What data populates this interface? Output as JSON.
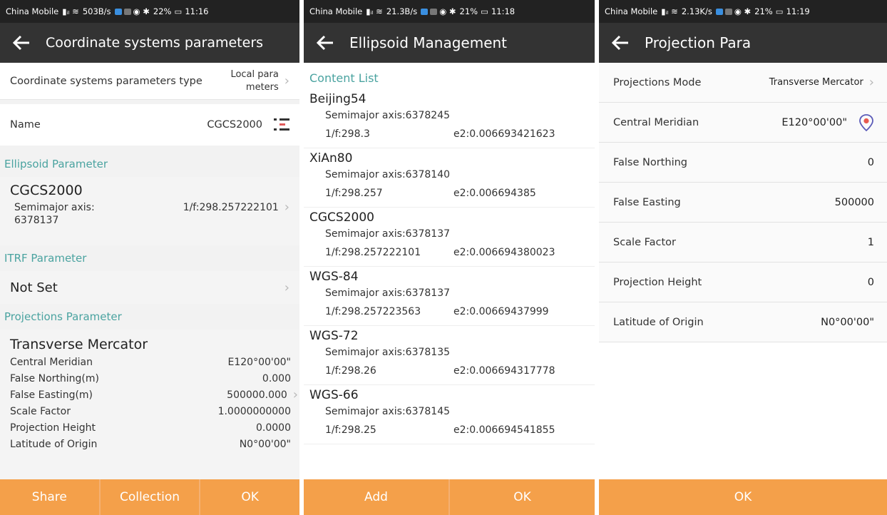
{
  "screen1": {
    "status": {
      "carrier": "China Mobile",
      "speed": "503B/s",
      "battery": "22%",
      "time": "11:16"
    },
    "title": "Coordinate systems parameters",
    "type_row": {
      "label": "Coordinate systems parameters type",
      "value": "Local para meters"
    },
    "name_row": {
      "label": "Name",
      "value": "CGCS2000"
    },
    "ellipsoid_section": "Ellipsoid Parameter",
    "ellipsoid": {
      "name": "CGCS2000",
      "semimajor_label": "Semimajor axis:",
      "semimajor_value": "6378137",
      "flattening": "1/f:298.257222101"
    },
    "itrf_section": "ITRF Parameter",
    "itrf_value": "Not Set",
    "projection_section": "Projections Parameter",
    "projection": {
      "name": "Transverse Mercator",
      "rows": [
        {
          "label": "Central Meridian",
          "value": "E120°00'00\""
        },
        {
          "label": "False Northing(m)",
          "value": "0.000"
        },
        {
          "label": "False Easting(m)",
          "value": "500000.000"
        },
        {
          "label": "Scale Factor",
          "value": "1.0000000000"
        },
        {
          "label": "Projection Height",
          "value": "0.0000"
        },
        {
          "label": "Latitude of Origin",
          "value": "N0°00'00\""
        }
      ]
    },
    "buttons": {
      "share": "Share",
      "collection": "Collection",
      "ok": "OK"
    }
  },
  "screen2": {
    "status": {
      "carrier": "China Mobile",
      "speed": "21.3B/s",
      "battery": "21%",
      "time": "11:18"
    },
    "title": "Ellipsoid Management",
    "list_header": "Content List",
    "items": [
      {
        "name": "Beijing54",
        "semimajor": "Semimajor axis:6378245",
        "f": "1/f:298.3",
        "e2": "e2:0.006693421623"
      },
      {
        "name": "XiAn80",
        "semimajor": "Semimajor axis:6378140",
        "f": "1/f:298.257",
        "e2": "e2:0.006694385"
      },
      {
        "name": "CGCS2000",
        "semimajor": "Semimajor axis:6378137",
        "f": "1/f:298.257222101",
        "e2": "e2:0.006694380023"
      },
      {
        "name": "WGS-84",
        "semimajor": "Semimajor axis:6378137",
        "f": "1/f:298.257223563",
        "e2": "e2:0.00669437999"
      },
      {
        "name": "WGS-72",
        "semimajor": "Semimajor axis:6378135",
        "f": "1/f:298.26",
        "e2": "e2:0.006694317778"
      },
      {
        "name": "WGS-66",
        "semimajor": "Semimajor axis:6378145",
        "f": "1/f:298.25",
        "e2": "e2:0.006694541855"
      }
    ],
    "buttons": {
      "add": "Add",
      "ok": "OK"
    }
  },
  "screen3": {
    "status": {
      "carrier": "China Mobile",
      "speed": "2.13K/s",
      "battery": "21%",
      "time": "11:19"
    },
    "title": "Projection Para",
    "rows": [
      {
        "label": "Projections Mode",
        "value": "Transverse Mercator"
      },
      {
        "label": "Central Meridian",
        "value": "E120°00'00\""
      },
      {
        "label": "False Northing",
        "value": "0"
      },
      {
        "label": "False Easting",
        "value": "500000"
      },
      {
        "label": "Scale Factor",
        "value": "1"
      },
      {
        "label": "Projection Height",
        "value": "0"
      },
      {
        "label": "Latitude of Origin",
        "value": "N0°00'00\""
      }
    ],
    "buttons": {
      "ok": "OK"
    }
  },
  "colors": {
    "accent_orange": "#f4a04a",
    "section_teal": "#4aa3a0",
    "titlebar": "#333333",
    "location_pin": "#e85a4f"
  },
  "icons": [
    "back-arrow-icon",
    "chevron-right-icon",
    "list-icon",
    "location-pin-icon",
    "signal-icon",
    "wifi-icon",
    "battery-icon"
  ]
}
